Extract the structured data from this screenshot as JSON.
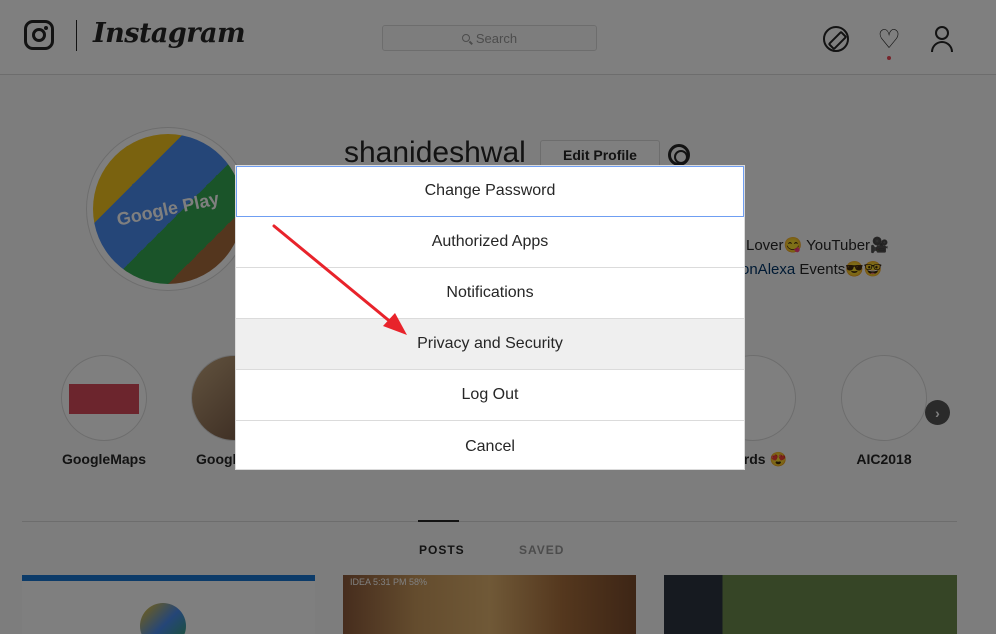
{
  "header": {
    "wordmark": "Instagram",
    "search_placeholder": "Search",
    "icons": [
      "instagram-glyph-icon",
      "compass-icon",
      "heart-icon",
      "user-icon"
    ],
    "notification_dot_color": "#ed4956"
  },
  "profile": {
    "username": "shanideshwal",
    "edit_button": "Edit Profile",
    "avatar_text": "Google Play",
    "bio_line_1": "Lover😋 YouTuber🎥",
    "bio_line_2_link": "onAlexa",
    "bio_line_2_rest": " Events😎🤓"
  },
  "highlights": [
    {
      "label": "GoogleMaps"
    },
    {
      "label": "Googl"
    },
    {
      "label": "ards 😍"
    },
    {
      "label": "AIC2018"
    }
  ],
  "highlights_next": "›",
  "tabs": {
    "posts": "POSTS",
    "saved": "SAVED"
  },
  "posts": {
    "status_text": "IDEA  5:31 PM  58%"
  },
  "dialog": {
    "items": [
      {
        "label": "Change Password"
      },
      {
        "label": "Authorized Apps"
      },
      {
        "label": "Notifications"
      },
      {
        "label": "Privacy and Security"
      },
      {
        "label": "Log Out"
      },
      {
        "label": "Cancel"
      }
    ]
  },
  "colors": {
    "overlay": "rgba(0,0,0,0.5)",
    "focus_outline": "#6f9ef2",
    "annotation_arrow": "#e8232b",
    "link": "#003569"
  }
}
